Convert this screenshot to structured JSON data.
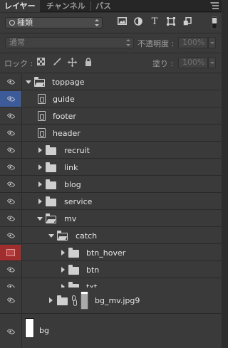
{
  "tabs": [
    {
      "label": "レイヤー",
      "active": true
    },
    {
      "label": "チャンネル",
      "active": false
    },
    {
      "label": "パス",
      "active": false
    }
  ],
  "filter": {
    "kind_label": "種類"
  },
  "blend": {
    "mode": "通常",
    "opacity_label": "不透明度 :",
    "opacity_value": "100%",
    "lock_label": "ロック :",
    "fill_label": "塗り :",
    "fill_value": "100%"
  },
  "layers": [
    {
      "name": "toppage",
      "type": "group-open",
      "eye": "visible"
    },
    {
      "name": "guide",
      "type": "smart",
      "eye": "visible-selected"
    },
    {
      "name": "footer",
      "type": "smart",
      "eye": "visible"
    },
    {
      "name": "header",
      "type": "smart",
      "eye": "visible"
    },
    {
      "name": "recruit",
      "type": "group",
      "eye": "visible"
    },
    {
      "name": "link",
      "type": "group",
      "eye": "visible"
    },
    {
      "name": "blog",
      "type": "group",
      "eye": "visible"
    },
    {
      "name": "service",
      "type": "group",
      "eye": "visible"
    },
    {
      "name": "mv",
      "type": "group-open",
      "eye": "visible"
    },
    {
      "name": "catch",
      "type": "group-open",
      "eye": "visible"
    },
    {
      "name": "btn_hover",
      "type": "group",
      "eye": "hidden-red"
    },
    {
      "name": "btn",
      "type": "group",
      "eye": "visible"
    },
    {
      "name": "txt",
      "type": "group",
      "eye": "visible"
    },
    {
      "name": "bg_mv.jpg9",
      "type": "group-mask",
      "eye": "visible"
    },
    {
      "name": "bg",
      "type": "layer",
      "eye": "visible"
    }
  ],
  "colors": {
    "selection": "#3e5b99",
    "hidden_marker": "#a12e2e",
    "panel": "#3a3a3a"
  }
}
